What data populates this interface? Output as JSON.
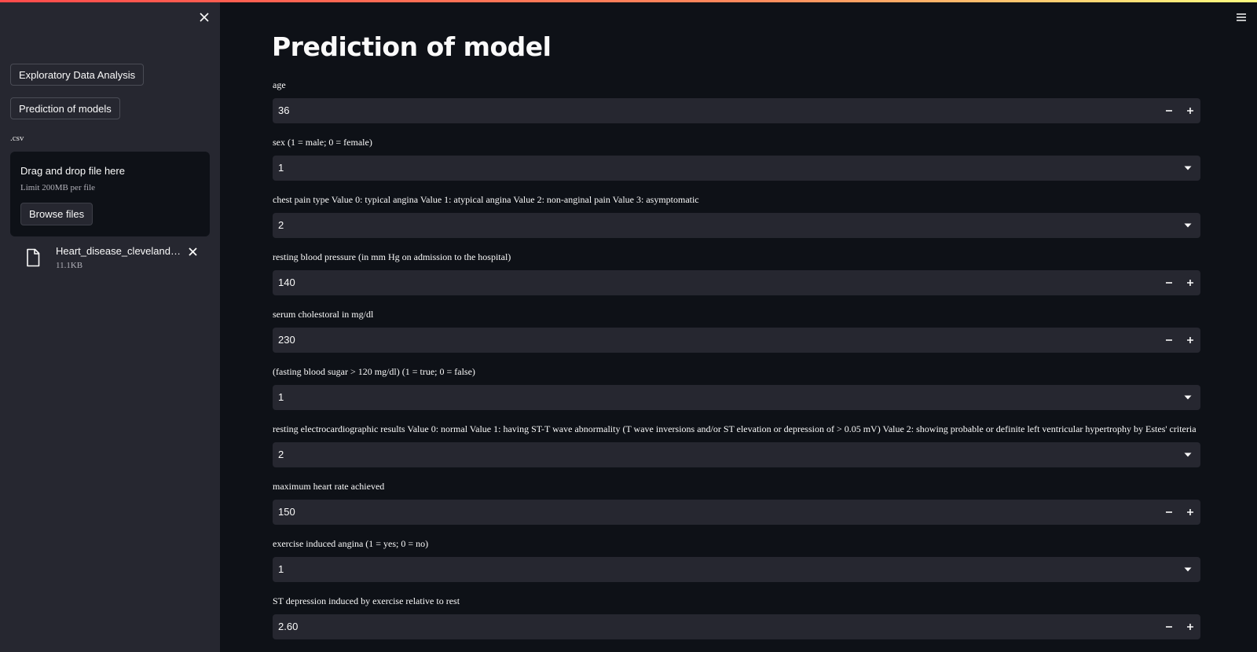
{
  "sidebar": {
    "nav_buttons": [
      "Exploratory Data Analysis",
      "Prediction of models"
    ],
    "uploader_label": ".csv",
    "dropzone_title": "Drag and drop file here",
    "dropzone_limit": "Limit 200MB per file",
    "browse_label": "Browse files",
    "file": {
      "name": "Heart_disease_cleveland_new.csv",
      "size": "11.1KB"
    }
  },
  "main": {
    "title": "Prediction of model",
    "fields": [
      {
        "label": "age",
        "value": "36",
        "kind": "number"
      },
      {
        "label": "sex (1 = male; 0 = female)",
        "value": "1",
        "kind": "select"
      },
      {
        "label": "chest pain type Value 0: typical angina Value 1: atypical angina Value 2: non-anginal pain Value 3: asymptomatic",
        "value": "2",
        "kind": "select"
      },
      {
        "label": "resting blood pressure (in mm Hg on admission to the hospital)",
        "value": "140",
        "kind": "number"
      },
      {
        "label": "serum cholestoral in mg/dl",
        "value": "230",
        "kind": "number"
      },
      {
        "label": "(fasting blood sugar > 120 mg/dl) (1 = true; 0 = false)",
        "value": "1",
        "kind": "select"
      },
      {
        "label": "resting electrocardiographic results Value 0: normal Value 1: having ST-T wave abnormality (T wave inversions and/or ST elevation or depression of > 0.05 mV) Value 2: showing probable or definite left ventricular hypertrophy by Estes' criteria",
        "value": "2",
        "kind": "select"
      },
      {
        "label": "maximum heart rate achieved",
        "value": "150",
        "kind": "number"
      },
      {
        "label": "exercise induced angina (1 = yes; 0 = no)",
        "value": "1",
        "kind": "select"
      },
      {
        "label": "ST depression induced by exercise relative to rest",
        "value": "2.60",
        "kind": "number"
      }
    ]
  }
}
